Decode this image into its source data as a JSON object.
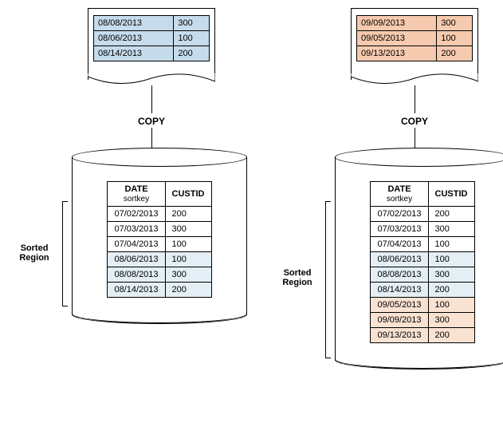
{
  "copy_label": "COPY",
  "region_label_line1": "Sorted",
  "region_label_line2": "Region",
  "headers": {
    "date": "DATE",
    "date_sub": "sortkey",
    "custid": "CUSTID"
  },
  "left": {
    "page_rows": [
      {
        "date": "08/08/2013",
        "val": "300"
      },
      {
        "date": "08/06/2013",
        "val": "100"
      },
      {
        "date": "08/14/2013",
        "val": "200"
      }
    ],
    "cyl_rows": [
      {
        "date": "07/02/2013",
        "custid": "200",
        "cls": ""
      },
      {
        "date": "07/03/2013",
        "custid": "300",
        "cls": ""
      },
      {
        "date": "07/04/2013",
        "custid": "100",
        "cls": ""
      },
      {
        "date": "08/06/2013",
        "custid": "100",
        "cls": "row-blue"
      },
      {
        "date": "08/08/2013",
        "custid": "300",
        "cls": "row-blue"
      },
      {
        "date": "08/14/2013",
        "custid": "200",
        "cls": "row-blue"
      }
    ]
  },
  "right": {
    "page_rows": [
      {
        "date": "09/09/2013",
        "val": "300"
      },
      {
        "date": "09/05/2013",
        "val": "100"
      },
      {
        "date": "09/13/2013",
        "val": "200"
      }
    ],
    "cyl_rows": [
      {
        "date": "07/02/2013",
        "custid": "200",
        "cls": ""
      },
      {
        "date": "07/03/2013",
        "custid": "300",
        "cls": ""
      },
      {
        "date": "07/04/2013",
        "custid": "100",
        "cls": ""
      },
      {
        "date": "08/06/2013",
        "custid": "100",
        "cls": "row-blue"
      },
      {
        "date": "08/08/2013",
        "custid": "300",
        "cls": "row-blue"
      },
      {
        "date": "08/14/2013",
        "custid": "200",
        "cls": "row-blue"
      },
      {
        "date": "09/05/2013",
        "custid": "100",
        "cls": "row-orange"
      },
      {
        "date": "09/09/2013",
        "custid": "300",
        "cls": "row-orange"
      },
      {
        "date": "09/13/2013",
        "custid": "200",
        "cls": "row-orange"
      }
    ]
  }
}
